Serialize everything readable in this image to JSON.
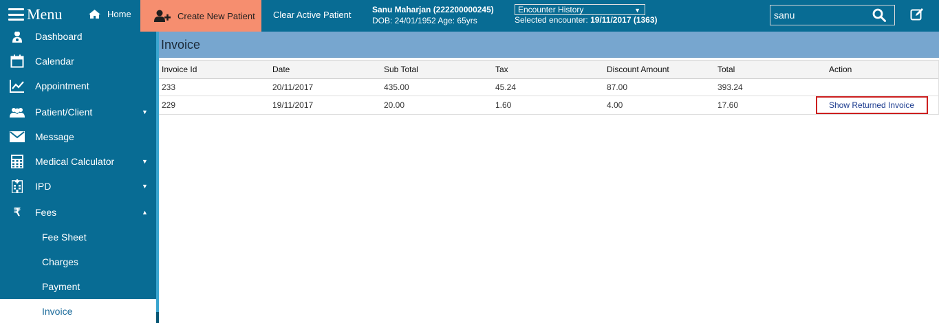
{
  "topbar": {
    "menu_label": "Menu",
    "home_label": "Home",
    "create_label": "Create New Patient",
    "clear_label": "Clear Active Patient",
    "patient_name": "Sanu Maharjan (222200000245)",
    "patient_details": "DOB: 24/01/1952 Age: 65yrs",
    "encounter_select": "Encounter History",
    "selected_encounter_label": "Selected encounter:",
    "selected_encounter_value": "19/11/2017 (1363)",
    "search_value": "sanu"
  },
  "sidebar": {
    "items": [
      {
        "label": "Dashboard",
        "icon": "dashboard-icon"
      },
      {
        "label": "Calendar",
        "icon": "calendar-icon"
      },
      {
        "label": "Appointment",
        "icon": "chart-icon"
      },
      {
        "label": "Patient/Client",
        "icon": "users-icon"
      },
      {
        "label": "Message",
        "icon": "envelope-icon"
      },
      {
        "label": "Medical Calculator",
        "icon": "calculator-icon"
      },
      {
        "label": "IPD",
        "icon": "hospital-icon"
      },
      {
        "label": "Fees",
        "icon": "rupee-icon"
      }
    ],
    "sub_items": [
      "Fee Sheet",
      "Charges",
      "Payment",
      "Invoice"
    ],
    "active": "Invoice"
  },
  "content": {
    "title": "Invoice",
    "columns": [
      "Invoice Id",
      "Date",
      "Sub Total",
      "Tax",
      "Discount Amount",
      "Total",
      "Action"
    ],
    "rows": [
      {
        "id": "233",
        "date": "20/11/2017",
        "sub_total": "435.00",
        "tax": "45.24",
        "discount": "87.00",
        "total": "393.24",
        "action": ""
      },
      {
        "id": "229",
        "date": "19/11/2017",
        "sub_total": "20.00",
        "tax": "1.60",
        "discount": "4.00",
        "total": "17.60",
        "action": "Show Returned Invoice"
      }
    ]
  },
  "colors": {
    "primary": "#086c94",
    "accent": "#f68e6f",
    "header_band": "#77a6cf",
    "highlight_border": "#cc1f1f"
  }
}
